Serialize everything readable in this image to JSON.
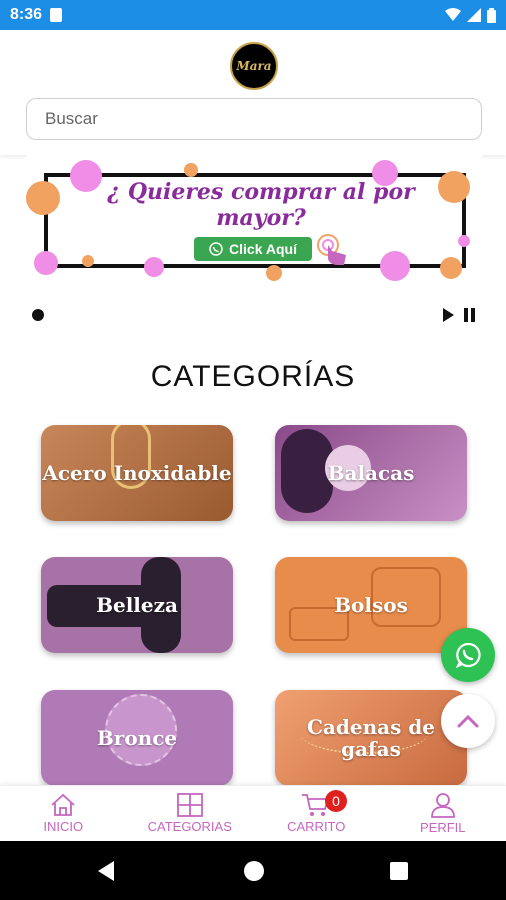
{
  "status_bar": {
    "time": "8:36"
  },
  "header": {
    "logo_text": "Mara",
    "search_placeholder": "Buscar"
  },
  "banner": {
    "title": "¿ Quieres comprar al por mayor?",
    "cta_label": "Click Aquí"
  },
  "categories": {
    "title": "CATEGORÍAS",
    "items": [
      {
        "label": "Acero Inoxidable"
      },
      {
        "label": "Balacas"
      },
      {
        "label": "Belleza"
      },
      {
        "label": "Bolsos"
      },
      {
        "label": "Bronce"
      },
      {
        "label": "Cadenas de gafas"
      }
    ]
  },
  "bottom_nav": {
    "items": [
      {
        "label": "INICIO",
        "icon": "home-icon"
      },
      {
        "label": "CATEGORIAS",
        "icon": "grid-icon"
      },
      {
        "label": "CARRITO",
        "icon": "cart-icon"
      },
      {
        "label": "PERFIL",
        "icon": "user-icon"
      }
    ],
    "cart_count": "0"
  },
  "colors": {
    "status_bar": "#1d8ee6",
    "accent": "#c566c0",
    "whatsapp": "#2dc253",
    "badge": "#e0201d"
  }
}
